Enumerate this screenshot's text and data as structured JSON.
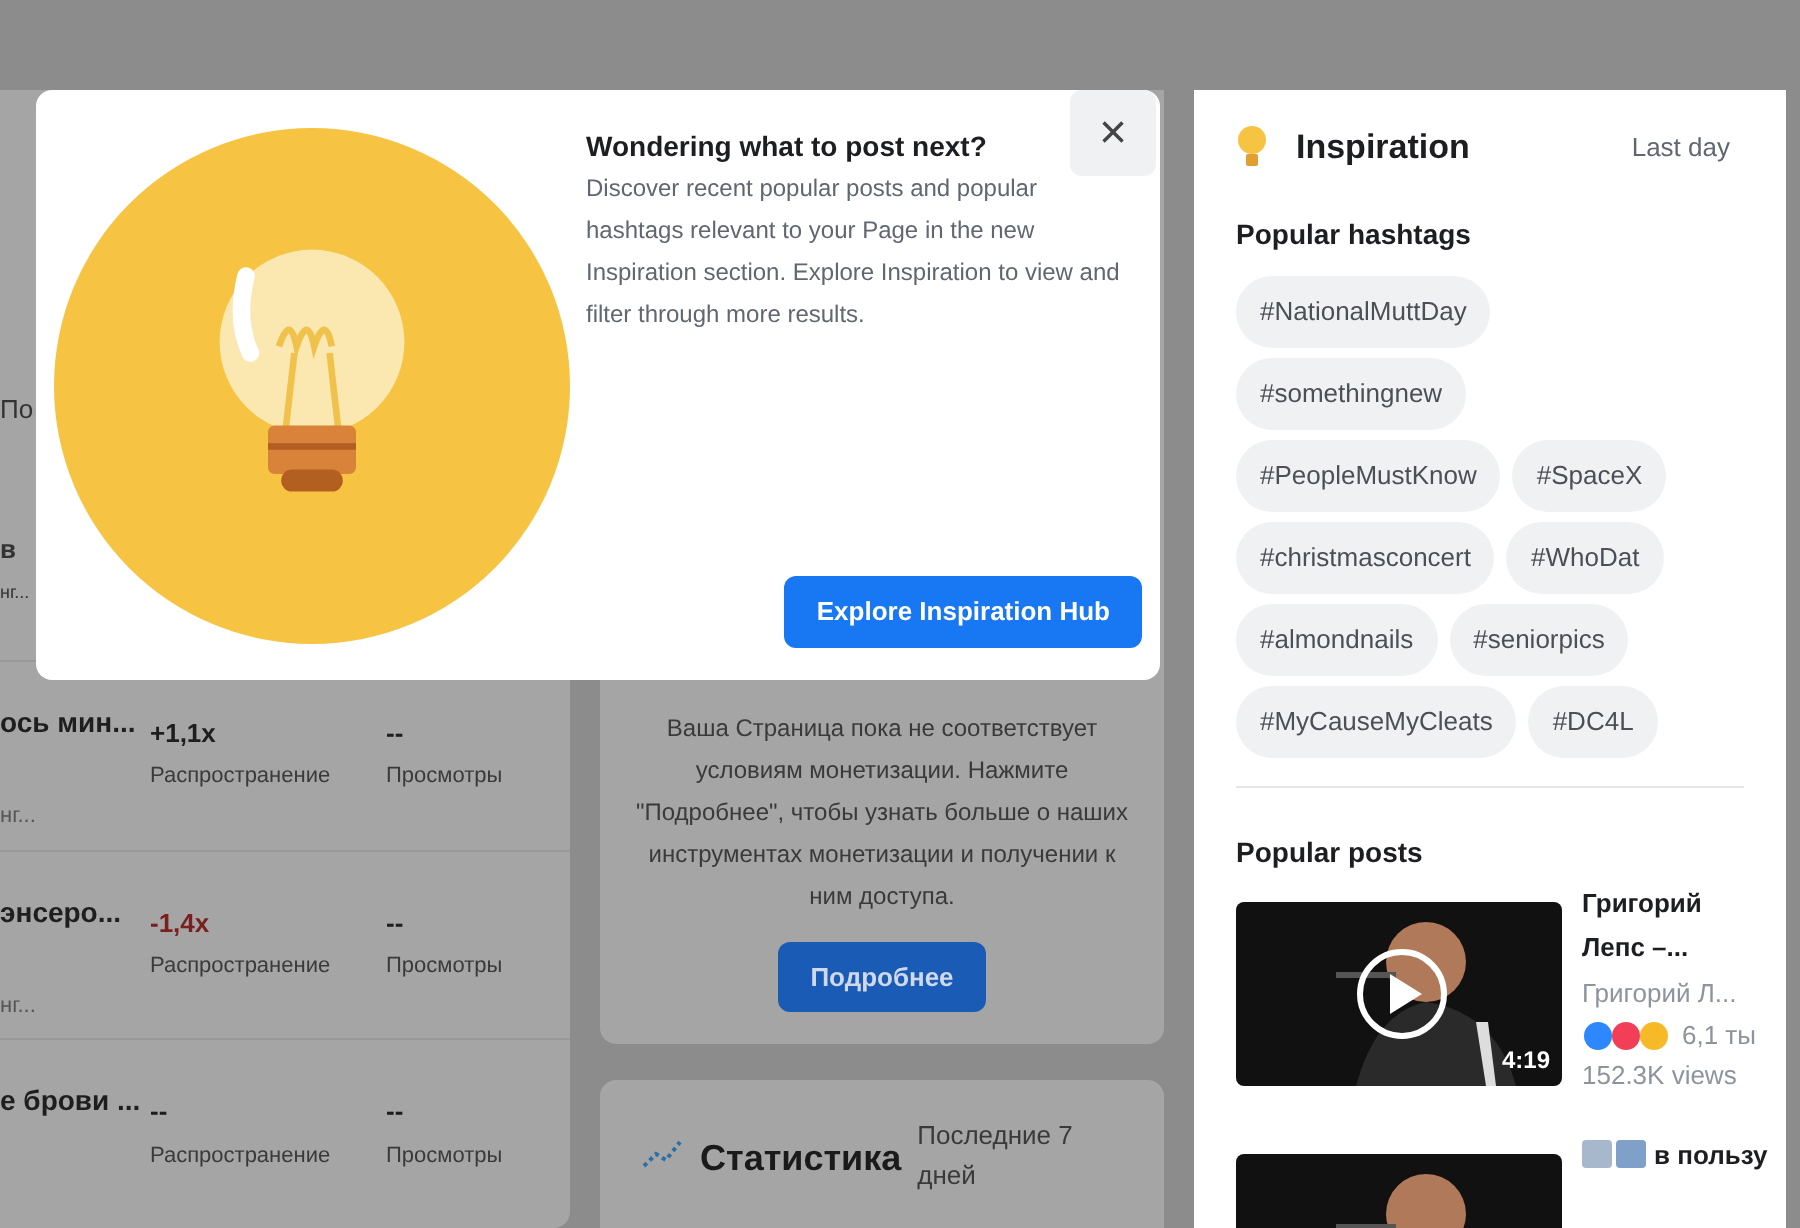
{
  "left_panel": {
    "fragments": [
      "По",
      "в",
      "нг..."
    ],
    "rows": [
      {
        "title": "ось мин...",
        "subtitle": "нг...",
        "metrics": [
          {
            "value": "+1,1x",
            "negative": false,
            "label": "Распространение"
          },
          {
            "value": "--",
            "negative": false,
            "label": "Просмотры"
          }
        ]
      },
      {
        "title": "энсеро...",
        "subtitle": "нг...",
        "metrics": [
          {
            "value": "-1,4x",
            "negative": true,
            "label": "Распространение"
          },
          {
            "value": "--",
            "negative": false,
            "label": "Просмотры"
          }
        ]
      },
      {
        "title": "е брови ...",
        "metrics": [
          {
            "value": "--",
            "negative": false,
            "label": "Распространение"
          },
          {
            "value": "--",
            "negative": false,
            "label": "Просмотры"
          }
        ]
      }
    ]
  },
  "monetization": {
    "text": "Ваша Страница пока не соответствует условиям монетизации. Нажмите \"Подробнее\", чтобы узнать больше о наших инструментах монетизации и получении к ним доступа.",
    "button": "Подробнее"
  },
  "statistics": {
    "title": "Статистика",
    "period": "Последние 7 дней"
  },
  "inspiration": {
    "title": "Inspiration",
    "period": "Last day",
    "hashtags_title": "Popular hashtags",
    "hashtags": [
      "#NationalMuttDay",
      "#somethingnew",
      "#PeopleMustKnow",
      "#SpaceX",
      "#christmasconcert",
      "#WhoDat",
      "#almondnails",
      "#seniorpics",
      "#MyCauseMyCleats",
      "#DC4L"
    ],
    "posts_title": "Popular posts",
    "posts": [
      {
        "title": "Григорий Лепс –...",
        "author": "Григорий Л...",
        "reactions": "6,1 ты",
        "views": "152.3K views",
        "duration": "4:19"
      },
      {
        "title": "в пользу"
      }
    ]
  },
  "popover": {
    "title": "Wondering what to post next?",
    "text": "Discover recent popular posts and popular hashtags relevant to your Page in the new Inspiration section. Explore Inspiration to view and filter through more results.",
    "close": "×",
    "button": "Explore Inspiration Hub"
  }
}
